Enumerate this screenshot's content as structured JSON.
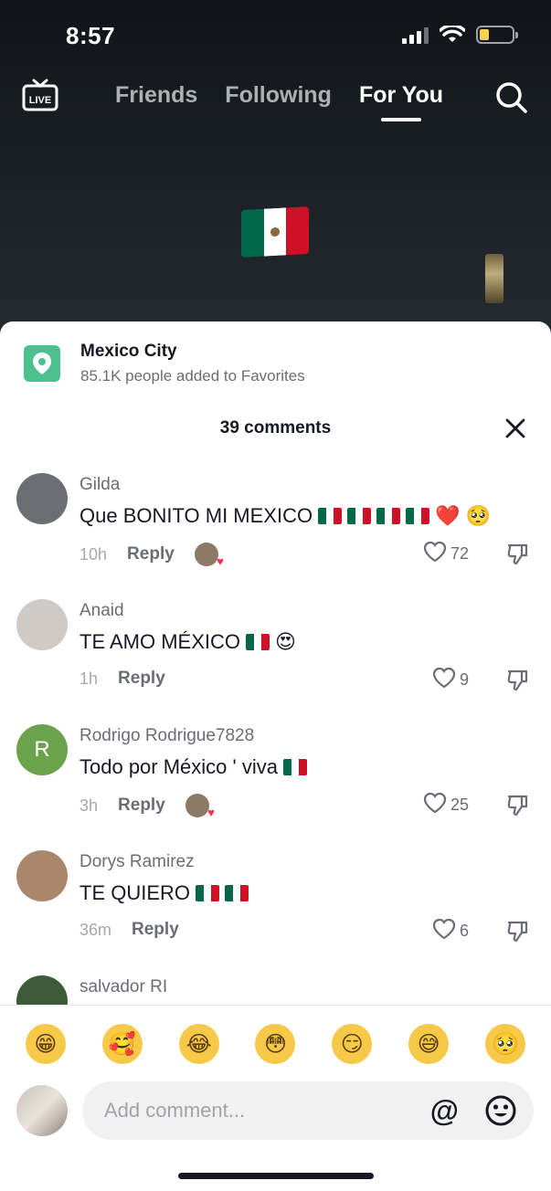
{
  "status": {
    "time": "8:57",
    "battery_level": 0.3
  },
  "nav": {
    "live_label": "LIVE",
    "tabs": [
      {
        "label": "Friends",
        "active": false
      },
      {
        "label": "Following",
        "active": false
      },
      {
        "label": "For You",
        "active": true
      }
    ]
  },
  "place": {
    "name": "Mexico City",
    "subtitle": "85.1K people added to Favorites"
  },
  "comments_header": "39 comments",
  "comments": [
    {
      "user": "Gilda",
      "text": "Que BONITO MI MEXICO",
      "emojis_after": [
        "flag-mx",
        "flag-mx",
        "flag-mx",
        "flag-mx",
        "❤️",
        "🥺"
      ],
      "time": "10h",
      "reply": "Reply",
      "liked_by_creator": true,
      "likes": "72",
      "avatar_color": "#6b6f74",
      "avatar_initial": ""
    },
    {
      "user": "Anaid",
      "text": "TE AMO MÉXICO",
      "emojis_after": [
        "flag-mx",
        "😍"
      ],
      "time": "1h",
      "reply": "Reply",
      "liked_by_creator": false,
      "likes": "9",
      "avatar_color": "#cfcac6",
      "avatar_initial": ""
    },
    {
      "user": "Rodrigo Rodrigue7828",
      "text": "Todo por México ' viva",
      "emojis_after": [
        "flag-mx"
      ],
      "time": "3h",
      "reply": "Reply",
      "liked_by_creator": true,
      "likes": "25",
      "avatar_color": "#6aa34b",
      "avatar_initial": "R"
    },
    {
      "user": "Dorys Ramirez",
      "text": "TE QUIERO",
      "emojis_after": [
        "flag-mx",
        "flag-mx"
      ],
      "time": "36m",
      "reply": "Reply",
      "liked_by_creator": false,
      "likes": "6",
      "avatar_color": "#a8876a",
      "avatar_initial": ""
    },
    {
      "user": "salvador RI",
      "text": "",
      "emojis_after": [],
      "time": "",
      "reply": "",
      "liked_by_creator": false,
      "likes": "",
      "avatar_color": "#3d5a3a",
      "avatar_initial": ""
    }
  ],
  "quick_emojis": [
    "😁",
    "🥰",
    "😂",
    "😳",
    "😏",
    "😅",
    "🥺"
  ],
  "composer": {
    "placeholder": "Add comment...",
    "at_symbol": "@"
  },
  "colors": {
    "accent_red": "#fe2c55",
    "place_green": "#4cc08e",
    "flag_green": "#006847",
    "flag_white": "#ffffff",
    "flag_red": "#ce1126"
  },
  "icons": [
    "live-icon",
    "search-icon",
    "location-pin-icon",
    "close-icon",
    "heart-icon",
    "dislike-icon",
    "smile-icon"
  ]
}
